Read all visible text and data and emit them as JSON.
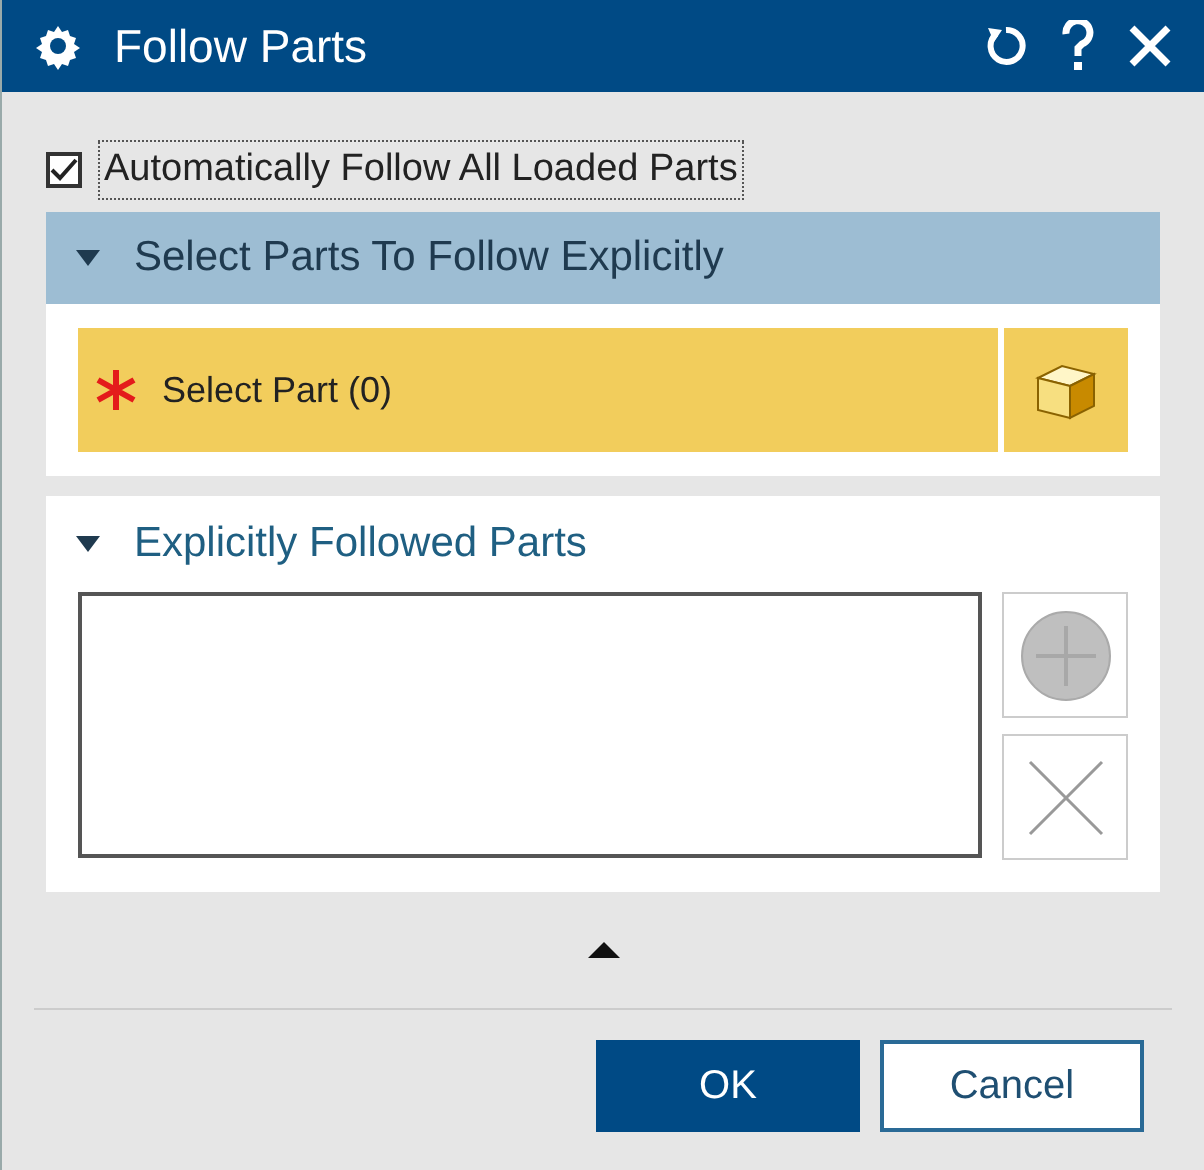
{
  "window": {
    "title": "Follow Parts"
  },
  "auto_follow": {
    "label": "Automatically Follow All Loaded Parts",
    "checked": true
  },
  "select_section": {
    "title": "Select Parts To Follow Explicitly",
    "expanded": true,
    "selector": {
      "label": "Select Part (0)"
    }
  },
  "followed_section": {
    "title": "Explicitly Followed Parts",
    "expanded": true
  },
  "buttons": [
    {
      "label": "OK",
      "kind": "primary"
    },
    {
      "label": "Cancel",
      "kind": "secondary"
    }
  ]
}
